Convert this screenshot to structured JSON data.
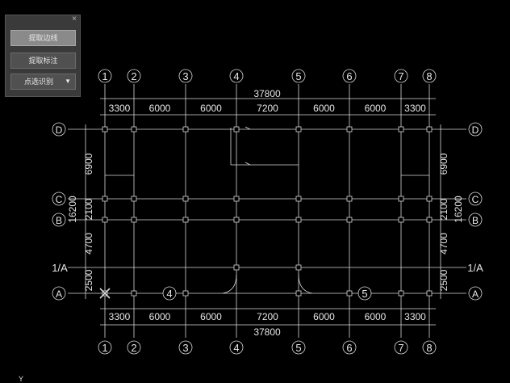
{
  "panel": {
    "close_glyph": "×",
    "buttons": [
      "提取边线",
      "提取标注",
      "点选识别"
    ],
    "dropdown_arrow": "▼"
  },
  "plan": {
    "grid_cols": [
      "1",
      "2",
      "3",
      "4",
      "5",
      "6",
      "7",
      "8"
    ],
    "grid_rows": [
      "D",
      "C",
      "B",
      "1/A",
      "A"
    ],
    "top_total": "37800",
    "bottom_total": "37800",
    "top_spans": [
      "3300",
      "6000",
      "6000",
      "7200",
      "6000",
      "6000",
      "3300"
    ],
    "bottom_spans": [
      "3300",
      "6000",
      "6000",
      "7200",
      "6000",
      "6000",
      "3300"
    ],
    "left_spans": [
      "6900",
      "2100",
      "4700",
      "2500"
    ],
    "right_spans": [
      "6900",
      "2100",
      "4700",
      "2500"
    ],
    "left_total": "16200",
    "right_total": "16200",
    "inline_tags": [
      "4",
      "5"
    ],
    "corner_mark": "Y"
  },
  "colors": {
    "background": "#000000",
    "line": "#d9d9d9",
    "panel": "#3a3a3a",
    "button_active": "#8a8a8a"
  }
}
